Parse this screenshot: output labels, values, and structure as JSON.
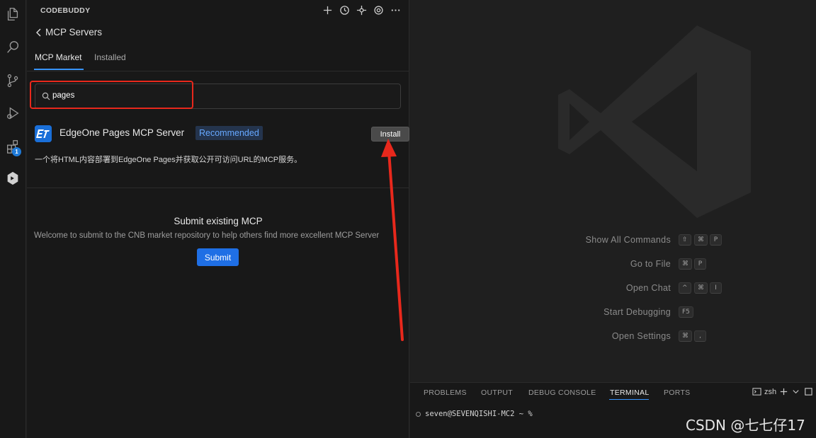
{
  "panel": {
    "title": "CODEBUDDY",
    "back_label": "MCP Servers",
    "tabs": [
      {
        "label": "MCP Market"
      },
      {
        "label": "Installed"
      }
    ],
    "search": {
      "value": "pages"
    },
    "server": {
      "name": "EdgeOne Pages MCP Server",
      "badge": "Recommended",
      "install_label": "Install",
      "description": "一个将HTML内容部署到EdgeOne Pages并获取公开可访问URL的MCP服务。"
    },
    "submit": {
      "title": "Submit existing MCP",
      "description": "Welcome to submit to the CNB market repository to help others find more excellent MCP Server",
      "button_label": "Submit"
    }
  },
  "activity_bar": {
    "extensions_badge": "1"
  },
  "editor": {
    "commands": [
      {
        "label": "Show All Commands",
        "keys": [
          "⇧",
          "⌘",
          "P"
        ]
      },
      {
        "label": "Go to File",
        "keys": [
          "⌘",
          "P"
        ]
      },
      {
        "label": "Open Chat",
        "keys": [
          "^",
          "⌘",
          "I"
        ]
      },
      {
        "label": "Start Debugging",
        "keys": [
          "F5"
        ]
      },
      {
        "label": "Open Settings",
        "keys": [
          "⌘",
          ","
        ]
      }
    ]
  },
  "bottom_panel": {
    "tabs": [
      {
        "label": "PROBLEMS"
      },
      {
        "label": "OUTPUT"
      },
      {
        "label": "DEBUG CONSOLE"
      },
      {
        "label": "TERMINAL"
      },
      {
        "label": "PORTS"
      }
    ],
    "shell": "zsh",
    "terminal_line": "seven@SEVENQISHI-MC2 ~ %"
  },
  "watermark": "CSDN @七七仔17",
  "colors": {
    "accent": "#3794ff",
    "highlight_red": "#e8281c",
    "submit_blue": "#1f6fe5"
  }
}
